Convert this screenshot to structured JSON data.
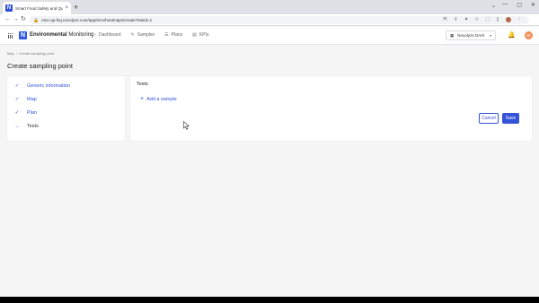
{
  "browser": {
    "tab_title": "Smart Food Safety and Quality | ...",
    "tab_close": "×",
    "new_tab": "+",
    "url": "emc-qa-fsq.novolyze.com/app/emc/heatmaps/create?siteId=1",
    "back": "←",
    "forward": "→",
    "reload": "↻",
    "lock": "🔒",
    "window_min": "—",
    "window_max": "▢",
    "window_close": "✕",
    "tab_list": "⌄"
  },
  "app": {
    "logo_letter": "N",
    "name_bold": "Environmental",
    "name_rest": " Monitoring",
    "nav": [
      {
        "label": "Dashboard",
        "icon": "◔"
      },
      {
        "label": "Samples",
        "icon": "✎"
      },
      {
        "label": "Plans",
        "icon": "☰"
      },
      {
        "label": "KPIs",
        "icon": "▤"
      }
    ],
    "site_selector": {
      "icon": "▦",
      "label": "Novolyze DAIX",
      "chevron": "▾"
    },
    "bell_icon": "🔔",
    "user_initials": "IC"
  },
  "breadcrumb": {
    "parent": "Map",
    "separator": "›",
    "current": "Create sampling point"
  },
  "page_title": "Create sampling point",
  "steps": [
    {
      "label": "Generic information",
      "mark": "✓",
      "state": "done"
    },
    {
      "label": "Map",
      "mark": "✓",
      "state": "done"
    },
    {
      "label": "Plan",
      "mark": "✓",
      "state": "done"
    },
    {
      "label": "Tests",
      "mark": "→",
      "state": "current"
    }
  ],
  "tests": {
    "title": "Tests",
    "add_sample_icon": "+",
    "add_sample_label": "Add a sample",
    "cancel_label": "Cancel",
    "save_label": "Save"
  },
  "colors": {
    "accent": "#3453d8",
    "background": "#f5f5f6"
  }
}
